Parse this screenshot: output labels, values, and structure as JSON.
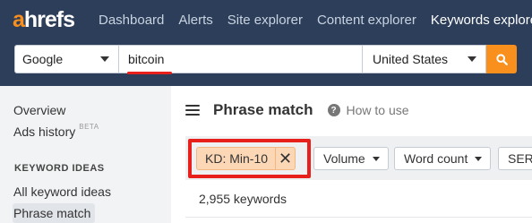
{
  "header": {
    "logo_a": "a",
    "logo_rest": "hrefs",
    "nav": [
      {
        "label": "Dashboard",
        "active": false
      },
      {
        "label": "Alerts",
        "active": false
      },
      {
        "label": "Site explorer",
        "active": false
      },
      {
        "label": "Content explorer",
        "active": false
      },
      {
        "label": "Keywords explorer",
        "active": true
      }
    ]
  },
  "search": {
    "engine": "Google",
    "query": "bitcoin",
    "country": "United States",
    "button_icon": "search-icon"
  },
  "sidebar": {
    "items": [
      {
        "label": "Overview"
      },
      {
        "label": "Ads history",
        "badge": "BETA"
      }
    ],
    "section_title": "KEYWORD IDEAS",
    "ideas": [
      {
        "label": "All keyword ideas",
        "selected": false
      },
      {
        "label": "Phrase match",
        "selected": true
      }
    ]
  },
  "main": {
    "title": "Phrase match",
    "help_label": "How to use",
    "help_icon": "question-icon",
    "menu_icon": "hamburger-icon",
    "active_filter": {
      "label": "KD: Min-10",
      "close_icon": "close-icon"
    },
    "filters": [
      {
        "label": "Volume"
      },
      {
        "label": "Word count"
      },
      {
        "label": "SER"
      }
    ],
    "keyword_count": "2,955 keywords"
  },
  "colors": {
    "header_bg": "#2c3e5a",
    "accent_orange": "#f98f1d",
    "highlight_red": "#e8201c",
    "chip_bg": "#fbd7b5"
  }
}
